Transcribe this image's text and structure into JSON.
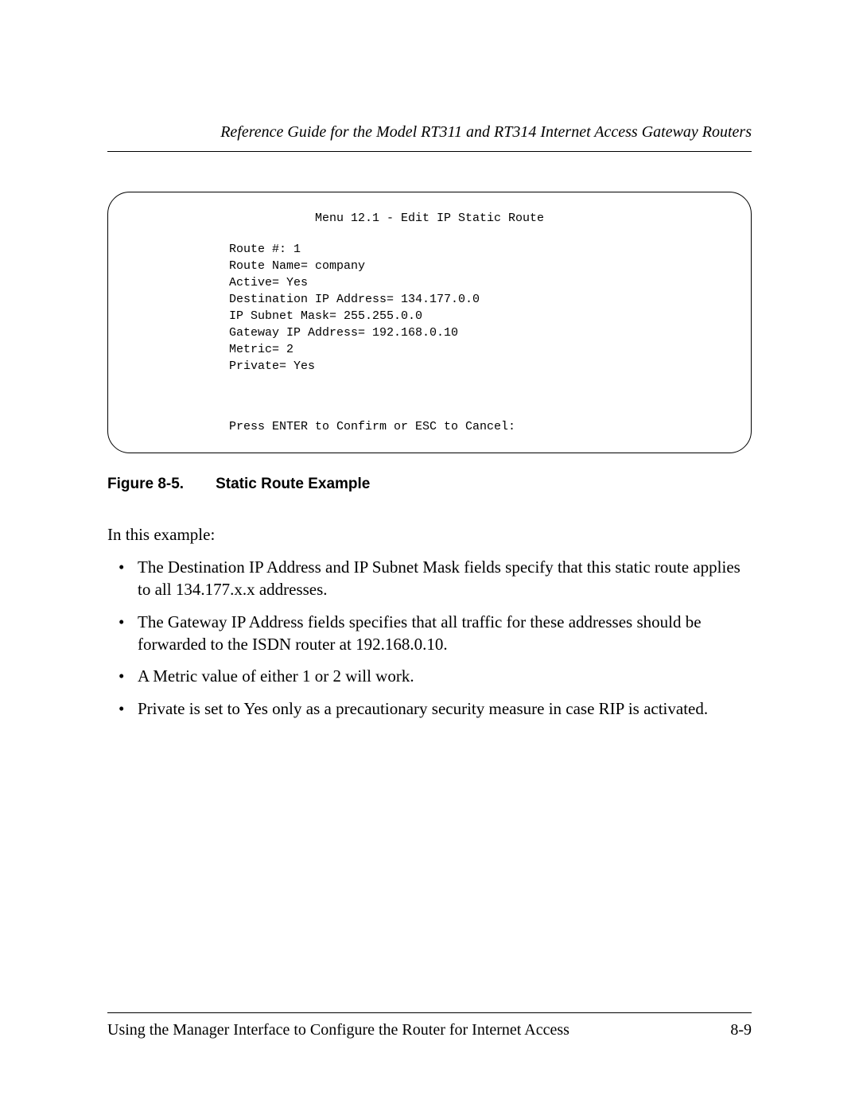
{
  "header": {
    "title": "Reference Guide for the Model RT311 and RT314 Internet Access Gateway Routers"
  },
  "terminal": {
    "title": "Menu 12.1 - Edit IP Static Route",
    "lines": {
      "l1": "Route #: 1",
      "l2": "Route Name= company",
      "l3": "Active= Yes",
      "l4": "Destination IP Address= 134.177.0.0",
      "l5": "IP Subnet Mask= 255.255.0.0",
      "l6": "Gateway IP Address= 192.168.0.10",
      "l7": "Metric= 2",
      "l8": "Private= Yes"
    },
    "footer": "Press ENTER to Confirm or ESC to Cancel:"
  },
  "figure": {
    "label": "Figure 8-5.",
    "title": "Static Route Example"
  },
  "intro": "In this example:",
  "bullets": {
    "b1": "The Destination IP Address and IP Subnet Mask fields specify that this static route applies to all 134.177.x.x addresses.",
    "b2": "The Gateway IP Address fields specifies that all traffic for these addresses should be forwarded to the ISDN router at 192.168.0.10.",
    "b3": "A Metric value of either 1 or 2 will work.",
    "b4": "Private is set to Yes only as a precautionary security measure in case RIP is activated."
  },
  "footer": {
    "chapter": "Using the Manager Interface to Configure the Router for Internet Access",
    "page": "8-9"
  }
}
